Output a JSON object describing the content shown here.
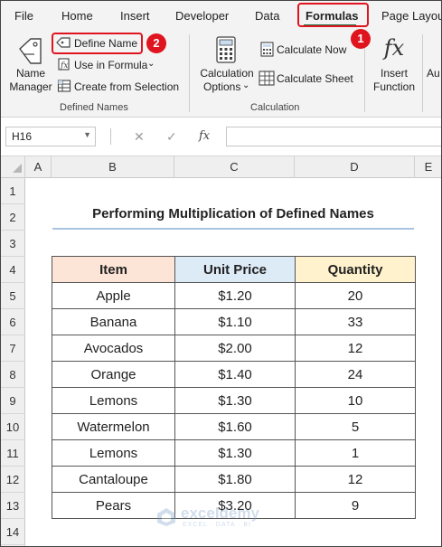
{
  "menu": {
    "tabs": [
      "File",
      "Home",
      "Insert",
      "Developer",
      "Data",
      "Formulas",
      "Page Layout"
    ],
    "active_tab": "Formulas"
  },
  "ribbon": {
    "defined_names": {
      "name_manager": [
        "Name",
        "Manager"
      ],
      "define_name": "Define Name",
      "use_in_formula": "Use in Formula",
      "create_from_selection": "Create from Selection",
      "group_label": "Defined Names"
    },
    "calculation": {
      "calculation_options": [
        "Calculation",
        "Options"
      ],
      "calculate_now": "Calculate Now",
      "calculate_sheet": "Calculate Sheet",
      "group_label": "Calculation"
    },
    "insert_function": [
      "Insert",
      "Function"
    ],
    "clipped_label": "Au"
  },
  "callouts": {
    "step1": "1",
    "step2": "2"
  },
  "formula_bar": {
    "name_box": "H16",
    "fx_label": "fx",
    "value": ""
  },
  "grid": {
    "columns": [
      "A",
      "B",
      "C",
      "D",
      "E"
    ],
    "rows": [
      "1",
      "2",
      "3",
      "4",
      "5",
      "6",
      "7",
      "8",
      "9",
      "10",
      "11",
      "12",
      "13",
      "14"
    ]
  },
  "sheet": {
    "title": "Performing Multiplication of Defined Names",
    "headers": [
      "Item",
      "Unit Price",
      "Quantity"
    ],
    "rows": [
      [
        "Apple",
        "$1.20",
        "20"
      ],
      [
        "Banana",
        "$1.10",
        "33"
      ],
      [
        "Avocados",
        "$2.00",
        "12"
      ],
      [
        "Orange",
        "$1.40",
        "24"
      ],
      [
        "Lemons",
        "$1.30",
        "10"
      ],
      [
        "Watermelon",
        "$1.60",
        "5"
      ],
      [
        "Lemons",
        "$1.30",
        "1"
      ],
      [
        "Cantaloupe",
        "$1.80",
        "12"
      ],
      [
        "Pears",
        "$3.20",
        "9"
      ]
    ]
  },
  "watermark": {
    "name": "exceldemy",
    "tagline": "EXCEL · DATA · BI"
  },
  "colors": {
    "accent_red": "#e0141e",
    "header_item": "#fce4d6",
    "header_price": "#ddebf7",
    "header_qty": "#fff2cc"
  }
}
